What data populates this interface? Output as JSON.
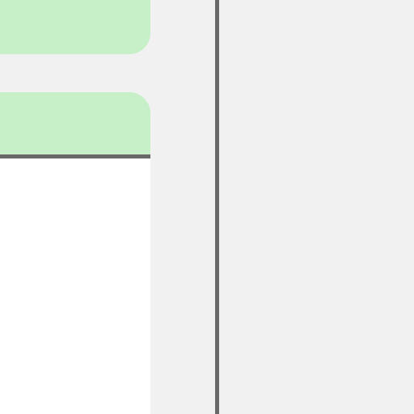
{
  "colors": {
    "page_background": "#f1f1f1",
    "tab_background": "#c7f0c8",
    "tab_underline": "#696969",
    "content_background": "#ffffff",
    "divider": "#696969"
  },
  "tabs": [
    {
      "label": ""
    },
    {
      "label": ""
    }
  ]
}
